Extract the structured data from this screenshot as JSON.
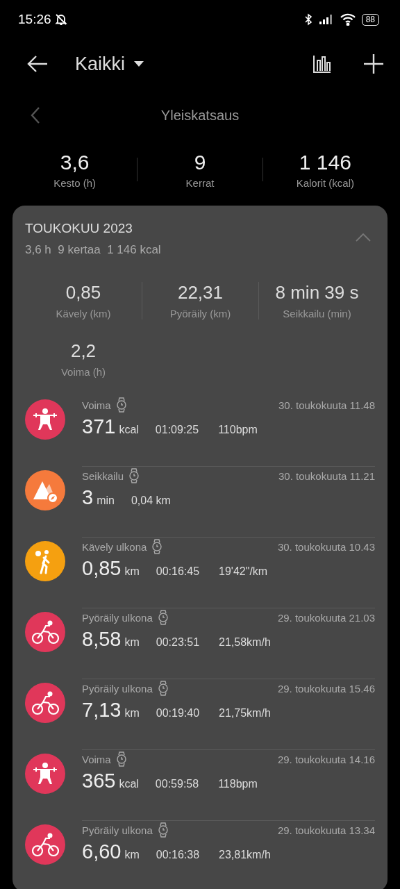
{
  "status_bar": {
    "time": "15:26",
    "battery": "88"
  },
  "header": {
    "title": "Kaikki"
  },
  "overview": {
    "title": "Yleiskatsaus",
    "stats": [
      {
        "value": "3,6",
        "label": "Kesto (h)"
      },
      {
        "value": "9",
        "label": "Kerrat"
      },
      {
        "value": "1 146",
        "label": "Kalorit (kcal)"
      }
    ]
  },
  "month": {
    "title": "TOUKOKUU 2023",
    "summary": "3,6 h  9 kertaa  1 146 kcal",
    "expanded": true,
    "stats": [
      {
        "value": "0,85",
        "label": "Kävely (km)"
      },
      {
        "value": "22,31",
        "label": "Pyöräily (km)"
      },
      {
        "value": "8 min 39 s",
        "label": "Seikkailu (min)"
      },
      {
        "value": "2,2",
        "label": "Voima (h)"
      }
    ]
  },
  "activities": [
    {
      "kind": "strength",
      "color": "#e0375a",
      "name": "Voima",
      "date": "30. toukokuuta 11.48",
      "value": "371",
      "unit": "kcal",
      "stats": [
        "01:09:25",
        "110bpm"
      ]
    },
    {
      "kind": "adventure",
      "color": "#f57a3c",
      "name": "Seikkailu",
      "date": "30. toukokuuta 11.21",
      "value": "3",
      "unit": "min",
      "stats": [
        "0,04 km"
      ]
    },
    {
      "kind": "walk",
      "color": "#f5a010",
      "name": "Kävely ulkona",
      "date": "30. toukokuuta 10.43",
      "value": "0,85",
      "unit": "km",
      "stats": [
        "00:16:45",
        "19'42\"/km"
      ]
    },
    {
      "kind": "cycle",
      "color": "#e0375a",
      "name": "Pyöräily ulkona",
      "date": "29. toukokuuta 21.03",
      "value": "8,58",
      "unit": "km",
      "stats": [
        "00:23:51",
        "21,58km/h"
      ]
    },
    {
      "kind": "cycle",
      "color": "#e0375a",
      "name": "Pyöräily ulkona",
      "date": "29. toukokuuta 15.46",
      "value": "7,13",
      "unit": "km",
      "stats": [
        "00:19:40",
        "21,75km/h"
      ]
    },
    {
      "kind": "strength",
      "color": "#e0375a",
      "name": "Voima",
      "date": "29. toukokuuta 14.16",
      "value": "365",
      "unit": "kcal",
      "stats": [
        "00:59:58",
        "118bpm"
      ]
    },
    {
      "kind": "cycle",
      "color": "#e0375a",
      "name": "Pyöräily ulkona",
      "date": "29. toukokuuta 13.34",
      "value": "6,60",
      "unit": "km",
      "stats": [
        "00:16:38",
        "23,81km/h"
      ]
    }
  ]
}
